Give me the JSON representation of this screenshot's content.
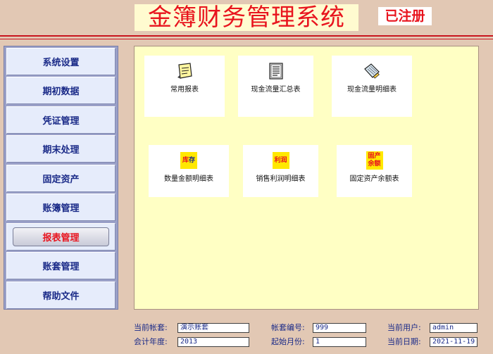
{
  "header": {
    "title": "金簿财务管理系统",
    "registered_badge": "已注册",
    "colors": {
      "title_red": "#e8141e",
      "title_bg": "#fffbd0"
    }
  },
  "sidebar": {
    "items": [
      {
        "label": "系统设置",
        "active": false
      },
      {
        "label": "期初数据",
        "active": false
      },
      {
        "label": "凭证管理",
        "active": false
      },
      {
        "label": "期末处理",
        "active": false
      },
      {
        "label": "固定资产",
        "active": false
      },
      {
        "label": "账簿管理",
        "active": false
      },
      {
        "label": "报表管理",
        "active": true
      },
      {
        "label": "账套管理",
        "active": false
      },
      {
        "label": "帮助文件",
        "active": false
      }
    ]
  },
  "main": {
    "tiles": [
      {
        "label": "常用报表",
        "icon": "notepad-icon"
      },
      {
        "label": "现金流量汇总表",
        "icon": "document-list-icon"
      },
      {
        "label": "现金流量明细表",
        "icon": "pencil-pad-icon"
      },
      {
        "label": "数量金额明细表",
        "icon": "inventory-tag-icon",
        "tag_text": [
          "库",
          "存"
        ]
      },
      {
        "label": "销售利润明细表",
        "icon": "profit-tag-icon",
        "tag_text": [
          "利润"
        ]
      },
      {
        "label": "固定资产余额表",
        "icon": "asset-balance-tag-icon",
        "tag_text": [
          "固产",
          "余额"
        ]
      }
    ]
  },
  "footer": {
    "current_account_label": "当前帐套:",
    "current_account_value": "演示账套",
    "account_no_label": "帐套编号:",
    "account_no_value": "999",
    "current_user_label": "当前用户:",
    "current_user_value": "admin",
    "fiscal_year_label": "会计年度:",
    "fiscal_year_value": "2013",
    "start_month_label": "起始月份:",
    "start_month_value": "1",
    "current_date_label": "当前日期:",
    "current_date_value": "2021-11-19"
  }
}
